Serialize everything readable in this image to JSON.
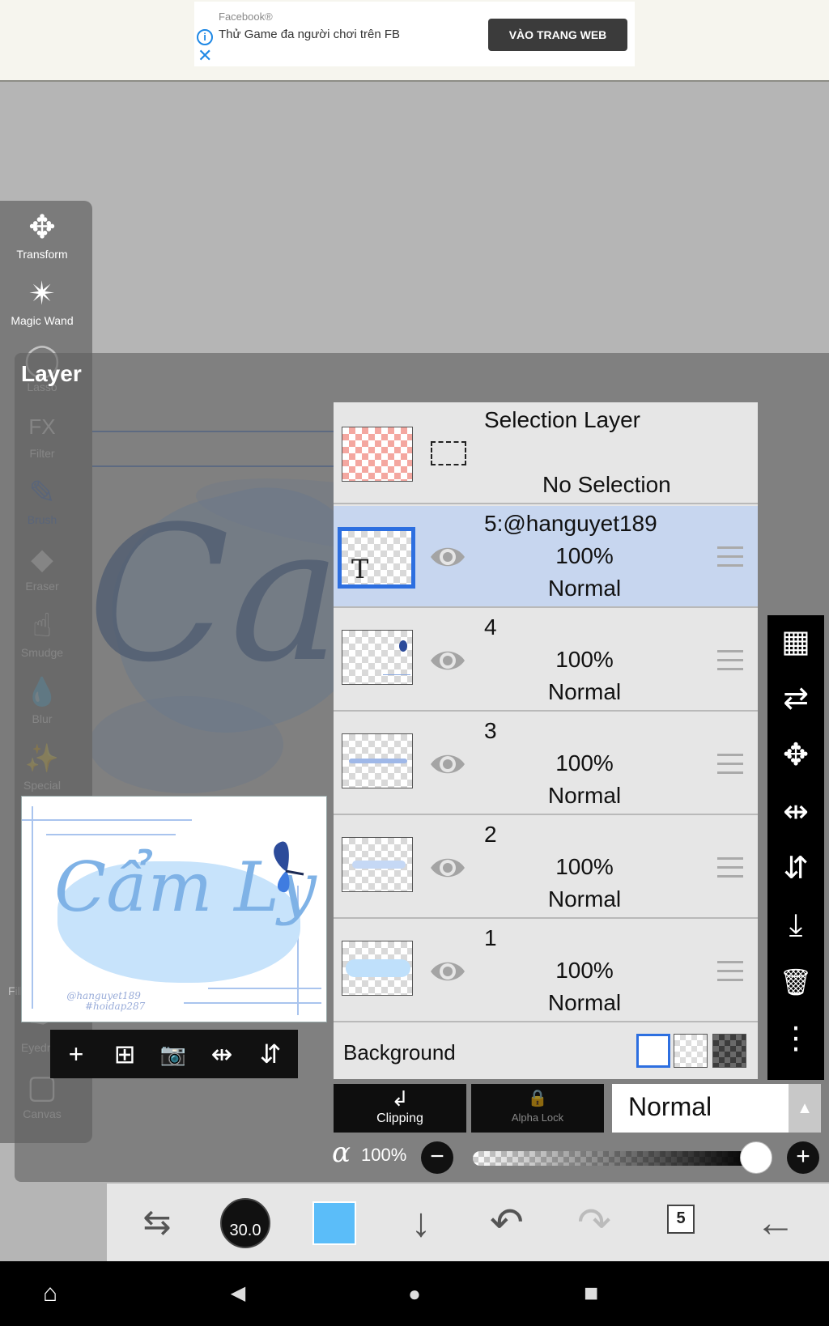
{
  "ad": {
    "sponsor": "Facebook®",
    "headline": "Thử Game đa người chơi trên FB",
    "cta": "VÀO TRANG WEB",
    "info_glyph": "i",
    "close_glyph": "✕"
  },
  "canvas_preview": {
    "main_text": "Cẩm Ly",
    "ghost_text": "Ca",
    "credit_line1": "@hanguyet189",
    "credit_line2": "#hoidap287"
  },
  "tools": [
    {
      "label": "Transform",
      "icon": "move-arrows-icon",
      "glyph": "✥"
    },
    {
      "label": "Magic Wand",
      "icon": "magic-wand-icon",
      "glyph": "✴"
    },
    {
      "label": "Lasso",
      "icon": "lasso-icon",
      "glyph": "◯"
    },
    {
      "label": "Filter",
      "icon": "fx-icon",
      "glyph": "FX"
    },
    {
      "label": "Brush",
      "icon": "brush-icon",
      "glyph": "✎"
    },
    {
      "label": "Eraser",
      "icon": "eraser-icon",
      "glyph": "⬥"
    },
    {
      "label": "Smudge",
      "icon": "smudge-icon",
      "glyph": "☝"
    },
    {
      "label": "Blur",
      "icon": "drop-icon",
      "glyph": "💧"
    },
    {
      "label": "Special",
      "icon": "special-brush-icon",
      "glyph": "✨"
    },
    {
      "label": "Fill",
      "icon": "fill-icon",
      "glyph": "▼"
    },
    {
      "label": "Eyedrop",
      "icon": "eyedropper-icon",
      "glyph": "✒"
    },
    {
      "label": "Canvas",
      "icon": "canvas-icon",
      "glyph": "▢"
    }
  ],
  "panel": {
    "title": "Layer"
  },
  "selection_layer": {
    "name": "Selection Layer",
    "status": "No Selection"
  },
  "layers": [
    {
      "name": "5:@hanguyet189",
      "opacity": "100%",
      "mode": "Normal",
      "selected": true,
      "thumb_letter": "T"
    },
    {
      "name": "4",
      "opacity": "100%",
      "mode": "Normal",
      "selected": false
    },
    {
      "name": "3",
      "opacity": "100%",
      "mode": "Normal",
      "selected": false
    },
    {
      "name": "2",
      "opacity": "100%",
      "mode": "Normal",
      "selected": false
    },
    {
      "name": "1",
      "opacity": "100%",
      "mode": "Normal",
      "selected": false
    }
  ],
  "background_row": {
    "label": "Background"
  },
  "controls": {
    "clipping": "Clipping",
    "clipping_glyph": "↲",
    "alpha_lock": "Alpha Lock",
    "alpha_lock_glyph": "🔒",
    "blend_mode": "Normal",
    "blend_arrow": "▲",
    "alpha_symbol": "α",
    "alpha_value": "100%",
    "alpha_fraction": 1.0,
    "minus_glyph": "−",
    "plus_glyph": "+"
  },
  "preview_tools": [
    {
      "icon": "add-layer-icon",
      "glyph": "+"
    },
    {
      "icon": "add-folder-icon",
      "glyph": "⊞"
    },
    {
      "icon": "camera-icon",
      "glyph": "📷"
    },
    {
      "icon": "flip-horizontal-icon",
      "glyph": "⇹"
    },
    {
      "icon": "flip-vertical-icon",
      "glyph": "⇵"
    }
  ],
  "right_tools": [
    {
      "icon": "transparency-checker-icon",
      "glyph": "▦"
    },
    {
      "icon": "swap-layers-icon",
      "glyph": "⇄"
    },
    {
      "icon": "move-icon",
      "glyph": "✥"
    },
    {
      "icon": "flip-horizontal-icon",
      "glyph": "⇹"
    },
    {
      "icon": "flip-vertical-icon",
      "glyph": "⇵"
    },
    {
      "icon": "merge-down-icon",
      "glyph": "⤓"
    },
    {
      "icon": "trash-icon",
      "glyph": "🗑"
    },
    {
      "icon": "more-vertical-icon",
      "glyph": "⋮"
    }
  ],
  "bottom_bar": {
    "brush_size": "30.0",
    "color": "#5bbdf9",
    "layer_count": "5",
    "tool_switch_glyph": "⇆",
    "down_glyph": "↓",
    "undo_glyph": "↶",
    "redo_glyph": "↷",
    "back_glyph": "←"
  },
  "nav": {
    "home_glyph": "⌂",
    "back_glyph": "◀",
    "circle_glyph": "●",
    "square_glyph": "■"
  }
}
